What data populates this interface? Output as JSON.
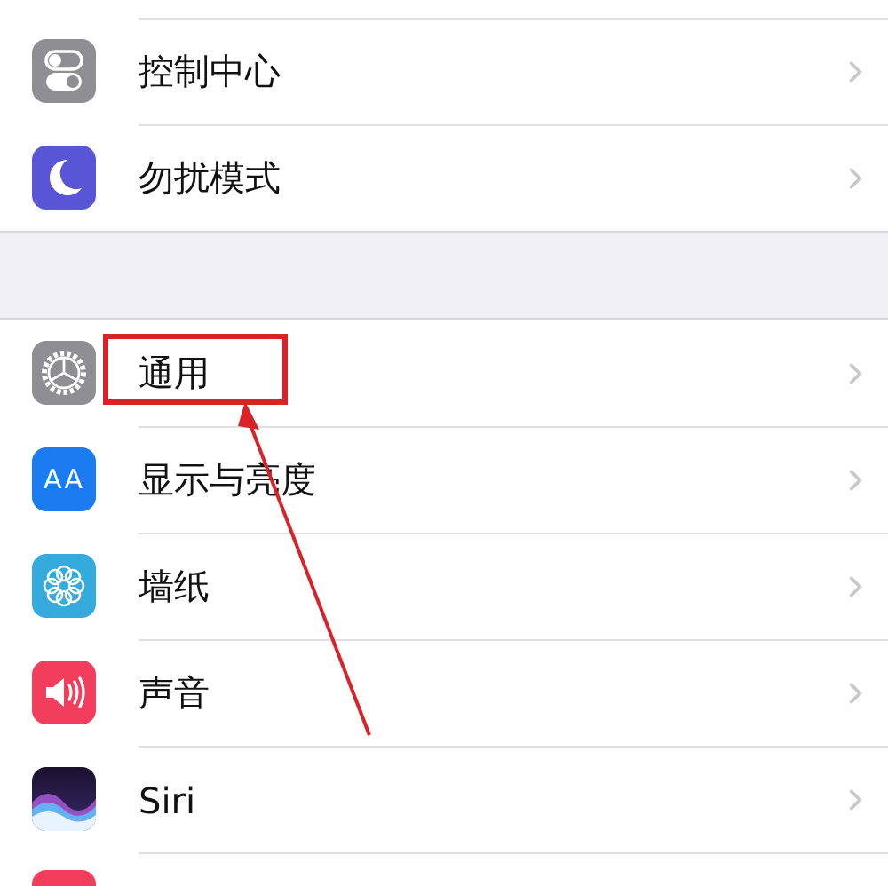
{
  "sections": [
    {
      "rows": [
        {
          "kind": "toggles",
          "label": "控制中心",
          "highlighted": false
        },
        {
          "kind": "moon",
          "label": "勿扰模式",
          "highlighted": false
        }
      ]
    },
    {
      "rows": [
        {
          "kind": "gear",
          "label": "通用",
          "highlighted": true
        },
        {
          "kind": "text-size",
          "icon_text": "AA",
          "label": "显示与亮度",
          "highlighted": false
        },
        {
          "kind": "flower",
          "label": "墙纸",
          "highlighted": false
        },
        {
          "kind": "speaker",
          "label": "声音",
          "highlighted": false
        },
        {
          "kind": "siri",
          "label": "Siri",
          "highlighted": false
        },
        {
          "kind": "partial"
        }
      ]
    }
  ]
}
